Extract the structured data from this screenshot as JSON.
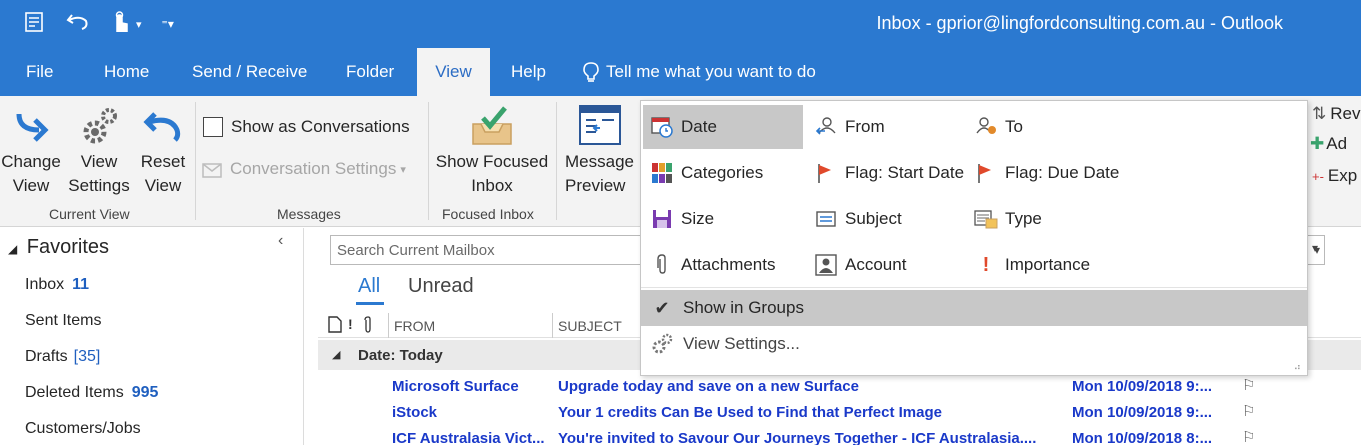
{
  "window": {
    "title": "Inbox - gprior@lingfordconsulting.com.au  -  Outlook"
  },
  "qat": {
    "icons": [
      "send-receive-icon",
      "undo-icon",
      "touch-mode-icon",
      "dropdown-icon",
      "customize-icon"
    ]
  },
  "tabs": [
    "File",
    "Home",
    "Send / Receive",
    "Folder",
    "View",
    "Help"
  ],
  "tellme": "Tell me what you want to do",
  "ribbon": {
    "change_view": "Change View",
    "view_settings": "View Settings",
    "reset_view": "Reset View",
    "current_view_group": "Current View",
    "show_as_conversations": "Show as Conversations",
    "conversation_settings": "Conversation Settings",
    "messages_group": "Messages",
    "show_focused_inbox": "Show Focused Inbox",
    "focused_inbox_group": "Focused Inbox",
    "message_preview": "Message Preview",
    "right_partial": [
      "Rev",
      "Ad",
      "Exp"
    ]
  },
  "favorites": {
    "title": "Favorites",
    "items": [
      {
        "label": "Inbox",
        "count": "11"
      },
      {
        "label": "Sent Items",
        "count": ""
      },
      {
        "label": "Drafts",
        "count": "[35]"
      },
      {
        "label": "Deleted Items",
        "count": "995"
      },
      {
        "label": "Customers/Jobs",
        "count": ""
      }
    ]
  },
  "search": {
    "placeholder": "Search Current Mailbox"
  },
  "filter": {
    "all": "All",
    "unread": "Unread"
  },
  "columns": {
    "from": "FROM",
    "subject": "SUBJECT"
  },
  "group": {
    "label": "Date: Today"
  },
  "emails": [
    {
      "from": "Microsoft Surface",
      "subject": "Upgrade today and save on a new Surface",
      "date": "Mon 10/09/2018 9:..."
    },
    {
      "from": "iStock",
      "subject": "Your 1 credits Can Be Used to Find that Perfect Image",
      "date": "Mon 10/09/2018 9:..."
    },
    {
      "from": "ICF Australasia Vict...",
      "subject": "You're invited to Savour Our Journeys Together - ICF Australasia....",
      "date": "Mon 10/09/2018 8:..."
    }
  ],
  "arrange_menu": {
    "items": [
      {
        "label": "Date",
        "icon": "calendar-clock-icon"
      },
      {
        "label": "From",
        "icon": "from-contact-icon"
      },
      {
        "label": "To",
        "icon": "to-contact-icon"
      },
      {
        "label": "Categories",
        "icon": "categories-icon"
      },
      {
        "label": "Flag: Start Date",
        "icon": "flag-icon"
      },
      {
        "label": "Flag: Due Date",
        "icon": "flag-icon"
      },
      {
        "label": "Size",
        "icon": "size-icon"
      },
      {
        "label": "Subject",
        "icon": "subject-icon"
      },
      {
        "label": "Type",
        "icon": "type-icon"
      },
      {
        "label": "Attachments",
        "icon": "paperclip-icon"
      },
      {
        "label": "Account",
        "icon": "account-icon"
      },
      {
        "label": "Importance",
        "icon": "importance-icon"
      }
    ],
    "show_in_groups": "Show in Groups",
    "view_settings": "View Settings..."
  },
  "colors": {
    "brand": "#2b79d0",
    "link": "#1f5fbf",
    "unread": "#1a39c9",
    "flag": "#e0492b"
  }
}
